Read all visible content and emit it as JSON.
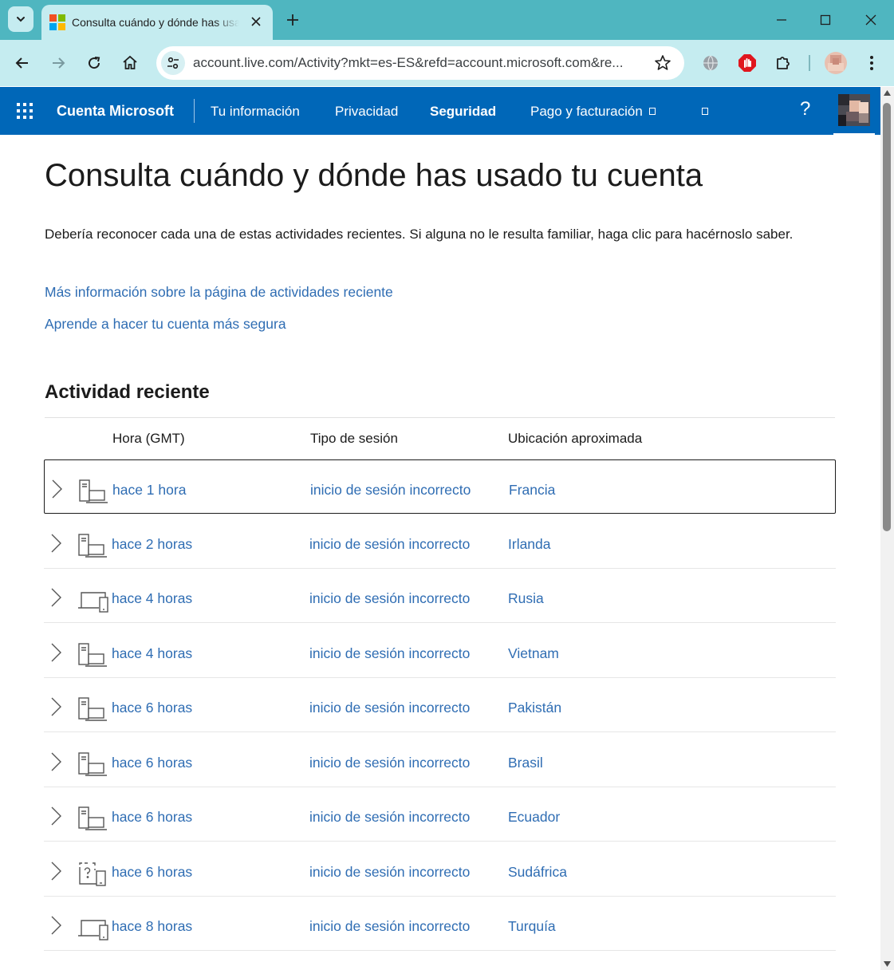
{
  "browser": {
    "tab_title": "Consulta cuándo y dónde has usado tu cuenta",
    "url": "account.live.com/Activity?mkt=es-ES&refd=account.microsoft.com&re..."
  },
  "header": {
    "brand": "Cuenta Microsoft",
    "nav": [
      "Tu información",
      "Privacidad",
      "Seguridad",
      "Pago y facturación"
    ],
    "active_nav": "Seguridad",
    "help": "?"
  },
  "page": {
    "title": "Consulta cuándo y dónde has usado tu cuenta",
    "intro": "Debería reconocer cada una de estas actividades recientes. Si alguna no le resulta familiar, haga clic para hacérnoslo saber.",
    "link_more_info": "Más información sobre la página de actividades reciente",
    "link_secure": "Aprende a hacer tu cuenta más segura",
    "section_title": "Actividad reciente",
    "columns": [
      "Hora (GMT)",
      "Tipo de sesión",
      "Ubicación aproximada"
    ]
  },
  "activity": [
    {
      "time": "hace 1 hora",
      "type": "inicio de sesión incorrecto",
      "location": "Francia",
      "device_icon": "desktop-laptop-icon"
    },
    {
      "time": "hace 2 horas",
      "type": "inicio de sesión incorrecto",
      "location": "Irlanda",
      "device_icon": "desktop-laptop-icon"
    },
    {
      "time": "hace 4 horas",
      "type": "inicio de sesión incorrecto",
      "location": "Rusia",
      "device_icon": "laptop-phone-icon"
    },
    {
      "time": "hace 4 horas",
      "type": "inicio de sesión incorrecto",
      "location": "Vietnam",
      "device_icon": "desktop-laptop-icon"
    },
    {
      "time": "hace 6 horas",
      "type": "inicio de sesión incorrecto",
      "location": "Pakistán",
      "device_icon": "desktop-laptop-icon"
    },
    {
      "time": "hace 6 horas",
      "type": "inicio de sesión incorrecto",
      "location": "Brasil",
      "device_icon": "desktop-laptop-icon"
    },
    {
      "time": "hace 6 horas",
      "type": "inicio de sesión incorrecto",
      "location": "Ecuador",
      "device_icon": "desktop-laptop-icon"
    },
    {
      "time": "hace 6 horas",
      "type": "inicio de sesión incorrecto",
      "location": "Sudáfrica",
      "device_icon": "unknown-device-icon"
    },
    {
      "time": "hace 8 horas",
      "type": "inicio de sesión incorrecto",
      "location": "Turquía",
      "device_icon": "laptop-phone-icon"
    }
  ],
  "colors": {
    "tabbar": "#4fb6c0",
    "toolbar": "#c5ecf0",
    "ms_blue": "#0067b8",
    "link": "#2f6db3"
  }
}
